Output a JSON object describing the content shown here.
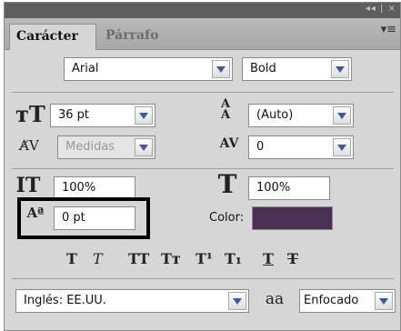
{
  "window": {
    "controls": "◂◂ | ×"
  },
  "tabs": [
    {
      "label": "Carácter",
      "active": true
    },
    {
      "label": "Párrafo",
      "active": false
    }
  ],
  "font": {
    "family": "Arial",
    "style": "Bold"
  },
  "size": {
    "value": "36 pt",
    "icon": "font-size-icon"
  },
  "leading": {
    "value": "(Auto)",
    "icon": "leading-icon"
  },
  "kerning": {
    "value": "Medidas",
    "disabled": true,
    "icon": "kerning-icon"
  },
  "tracking": {
    "value": "0",
    "icon": "tracking-icon"
  },
  "vertical_scale": {
    "value": "100%",
    "icon": "vertical-scale-icon"
  },
  "horizontal_scale": {
    "value": "100%",
    "icon": "horizontal-scale-icon"
  },
  "baseline_shift": {
    "value": "0 pt",
    "icon": "baseline-shift-icon"
  },
  "color": {
    "label": "Color:",
    "value": "#4c2f55"
  },
  "type_styles": [
    {
      "name": "faux-bold",
      "glyph": "T"
    },
    {
      "name": "faux-italic",
      "glyph": "T"
    },
    {
      "name": "all-caps",
      "glyph": "TT"
    },
    {
      "name": "small-caps",
      "glyph": "Tт"
    },
    {
      "name": "superscript",
      "glyph": "T¹"
    },
    {
      "name": "subscript",
      "glyph": "T₁"
    },
    {
      "name": "underline",
      "glyph": "T"
    },
    {
      "name": "strikethrough",
      "glyph": "T"
    }
  ],
  "language": {
    "value": "Inglés: EE.UU."
  },
  "antialias": {
    "icon_text": "aa",
    "value": "Enfocado"
  }
}
